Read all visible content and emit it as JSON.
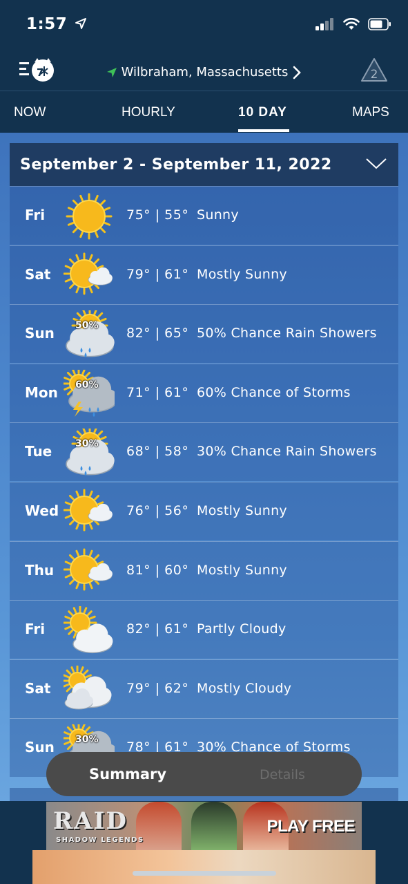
{
  "status_bar": {
    "time": "1:57"
  },
  "header": {
    "location": "Wilbraham, Massachusetts",
    "alerts_count": "2"
  },
  "tabs": [
    {
      "label": "NOW",
      "active": false
    },
    {
      "label": "HOURLY",
      "active": false
    },
    {
      "label": "10 DAY",
      "active": true
    },
    {
      "label": "MAPS",
      "active": false
    }
  ],
  "forecast": {
    "range_title": "September 2 - September 11, 2022",
    "days": [
      {
        "day": "Fri",
        "temps": "75° | 55°",
        "condition": "Sunny",
        "icon": "sunny-icon",
        "precip": ""
      },
      {
        "day": "Sat",
        "temps": "79° | 61°",
        "condition": "Mostly Sunny",
        "icon": "mostly-sunny-icon",
        "precip": ""
      },
      {
        "day": "Sun",
        "temps": "82° | 65°",
        "condition": "50% Chance Rain Showers",
        "icon": "rain-showers-icon",
        "precip": "50%"
      },
      {
        "day": "Mon",
        "temps": "71° | 61°",
        "condition": "60% Chance of Storms",
        "icon": "thunderstorm-icon",
        "precip": "60%"
      },
      {
        "day": "Tue",
        "temps": "68° | 58°",
        "condition": "30% Chance Rain Showers",
        "icon": "rain-showers-icon",
        "precip": "30%"
      },
      {
        "day": "Wed",
        "temps": "76° | 56°",
        "condition": "Mostly Sunny",
        "icon": "mostly-sunny-icon",
        "precip": ""
      },
      {
        "day": "Thu",
        "temps": "81° | 60°",
        "condition": "Mostly Sunny",
        "icon": "mostly-sunny-icon",
        "precip": ""
      },
      {
        "day": "Fri",
        "temps": "82° | 61°",
        "condition": "Partly Cloudy",
        "icon": "partly-cloudy-icon",
        "precip": ""
      },
      {
        "day": "Sat",
        "temps": "79° | 62°",
        "condition": "Mostly Cloudy",
        "icon": "mostly-cloudy-icon",
        "precip": ""
      },
      {
        "day": "Sun",
        "temps": "78° | 61°",
        "condition": "30% Chance of Storms",
        "icon": "thunderstorm-icon",
        "precip": "30%"
      }
    ]
  },
  "toggle": {
    "summary": "Summary",
    "details": "Details"
  },
  "ad": {
    "brand": "RAID",
    "tagline": "SHADOW LEGENDS",
    "cta": "PLAY FREE"
  },
  "colors": {
    "header_bg": "#12324e",
    "row_bg": "#3e73bc",
    "sun": "#f5c21b",
    "toggle_bg": "#4a4a4a"
  }
}
